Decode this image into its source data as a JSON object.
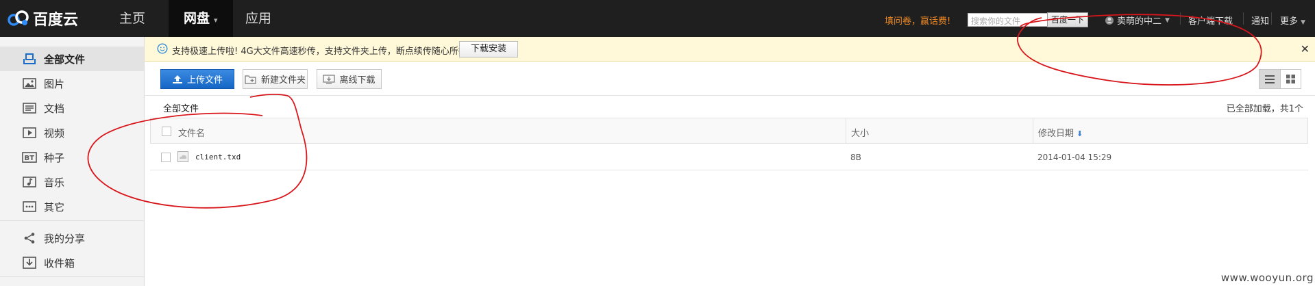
{
  "header": {
    "logo_text": "百度云",
    "nav": [
      {
        "label": "主页"
      },
      {
        "label": "网盘"
      },
      {
        "label": "应用"
      }
    ],
    "promo": "填问卷，赢话费!",
    "search_placeholder": "搜索你的文件",
    "search_button": "百度一下",
    "username": "卖萌的中二",
    "links": [
      "客户端下载",
      "通知",
      "更多"
    ]
  },
  "sidebar": {
    "items": [
      {
        "label": "全部文件",
        "icon": "folder-icon"
      },
      {
        "label": "图片",
        "icon": "image-icon"
      },
      {
        "label": "文档",
        "icon": "document-icon"
      },
      {
        "label": "视频",
        "icon": "video-icon"
      },
      {
        "label": "种子",
        "icon": "bt-icon"
      },
      {
        "label": "音乐",
        "icon": "music-icon"
      },
      {
        "label": "其它",
        "icon": "more-icon"
      },
      {
        "label": "我的分享",
        "icon": "share-icon"
      },
      {
        "label": "收件箱",
        "icon": "inbox-icon"
      }
    ]
  },
  "notice": {
    "text": "支持极速上传啦! 4G大文件高速秒传，支持文件夹上传，断点续传随心所欲!",
    "button": "下载安装"
  },
  "toolbar": {
    "upload": "上传文件",
    "new_folder": "新建文件夹",
    "offline_download": "离线下载"
  },
  "file_list": {
    "breadcrumb": "全部文件",
    "status": "已全部加载，共1个",
    "columns": [
      "文件名",
      "大小",
      "修改日期"
    ],
    "rows": [
      {
        "name": "client.txd",
        "size": "8B",
        "modified": "2014-01-04 15:29"
      }
    ]
  },
  "watermark": "www.wooyun.org",
  "colors": {
    "topbar": "#1f1f1f",
    "accent_blue": "#1a6cc9",
    "promo_orange": "#f08a24",
    "annotation_red": "#d8161b"
  }
}
